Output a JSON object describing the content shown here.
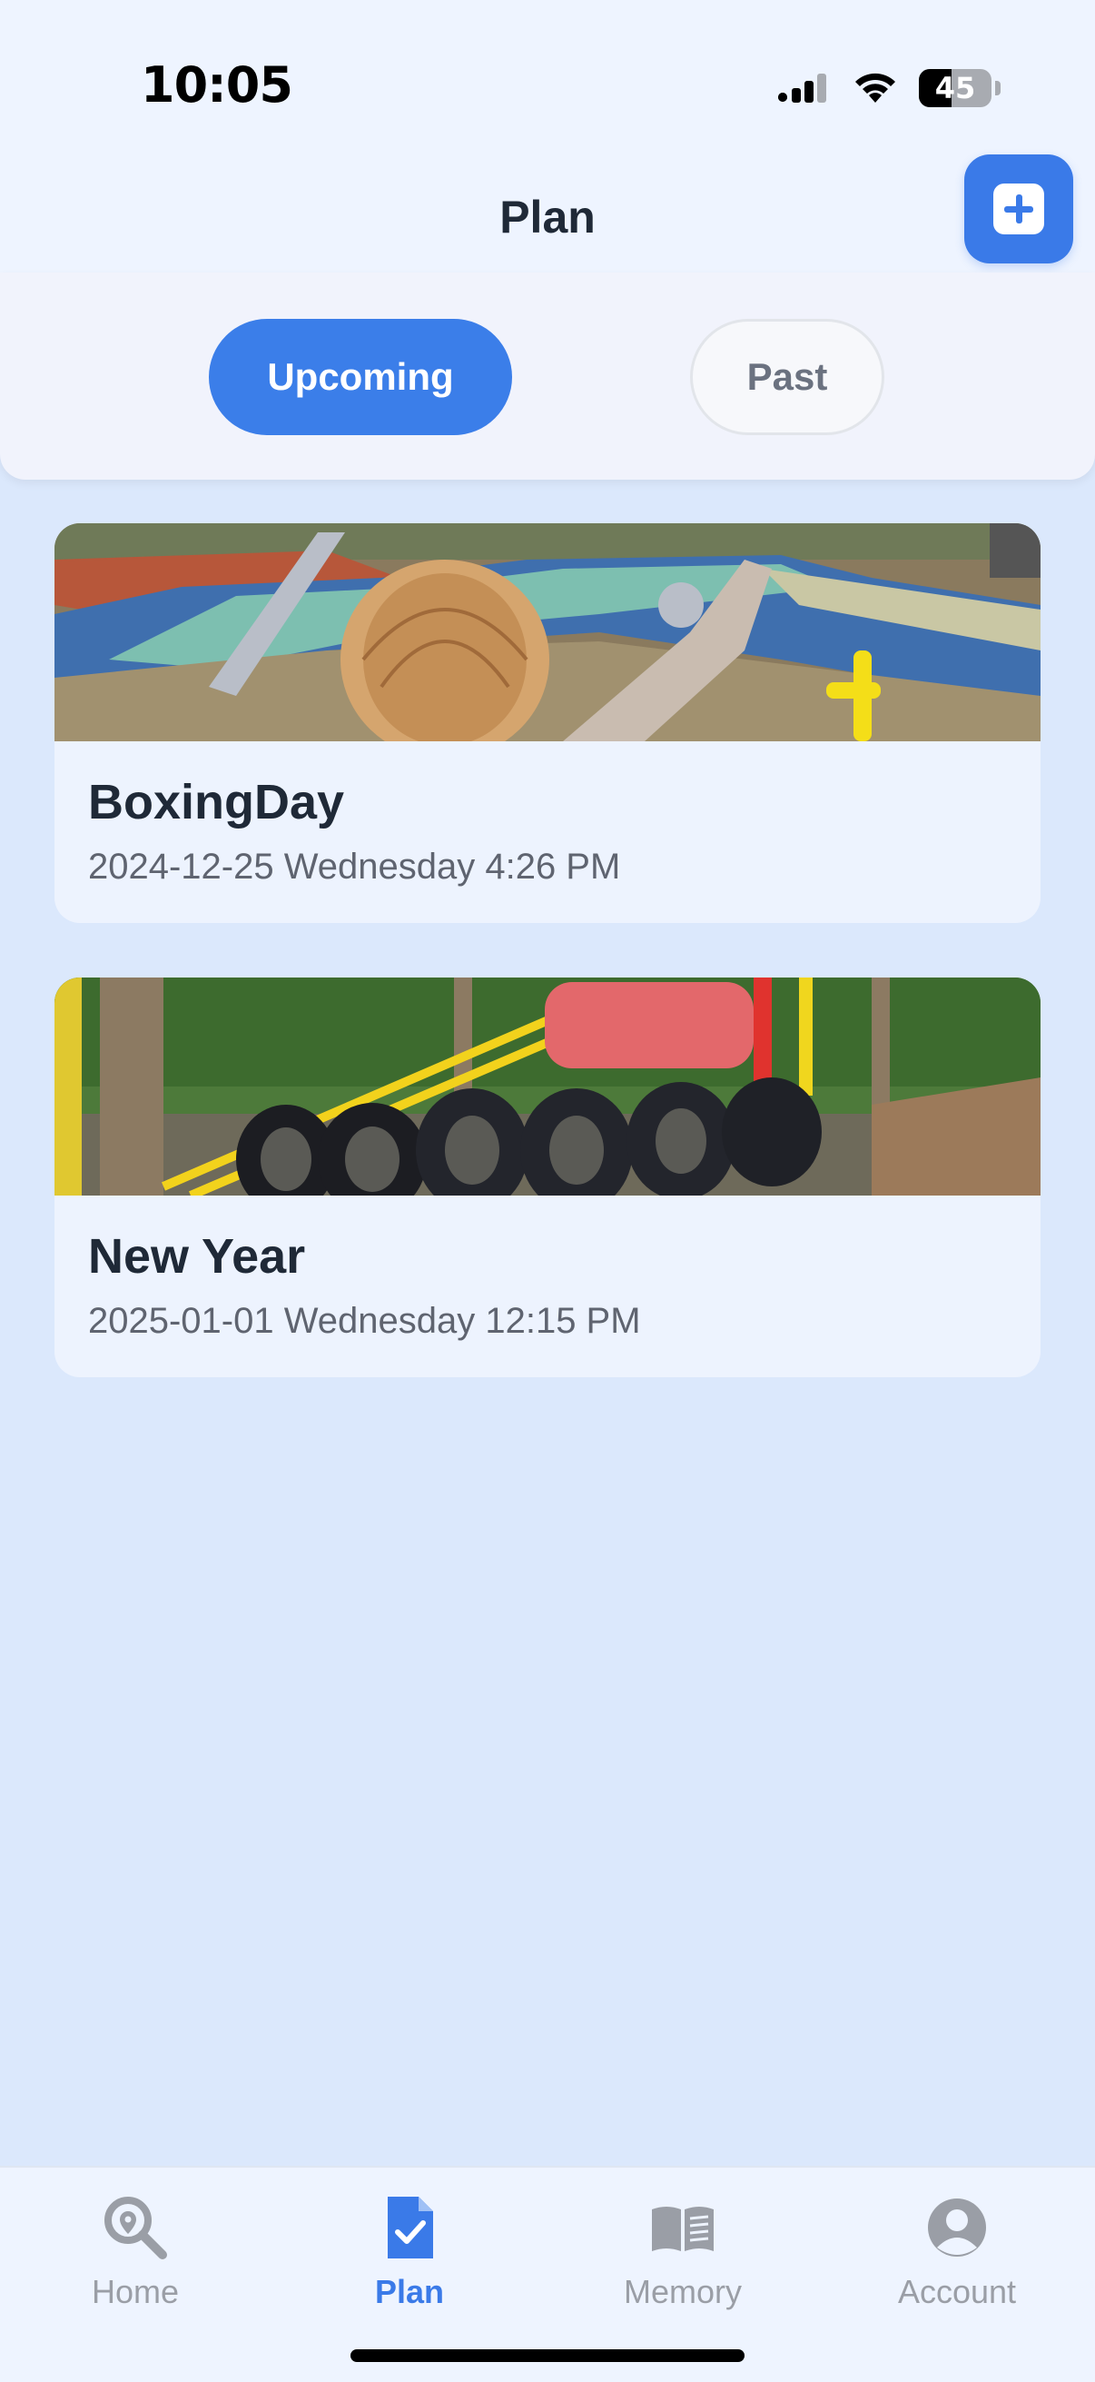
{
  "status_bar": {
    "time": "10:05",
    "battery": "45"
  },
  "header": {
    "title": "Plan"
  },
  "filter": {
    "upcoming_label": "Upcoming",
    "past_label": "Past"
  },
  "plans": [
    {
      "title": "BoxingDay",
      "date": "2024-12-25 Wednesday 4:26 PM"
    },
    {
      "title": "New Year",
      "date": "2025-01-01 Wednesday 12:15 PM"
    }
  ],
  "tabbar": {
    "items": [
      {
        "label": "Home",
        "icon": "search-pin-icon"
      },
      {
        "label": "Plan",
        "icon": "plan-document-icon"
      },
      {
        "label": "Memory",
        "icon": "book-icon"
      },
      {
        "label": "Account",
        "icon": "person-icon"
      }
    ],
    "active": "Plan"
  },
  "colors": {
    "accent": "#3a7ae8",
    "background": "#dbe8fc",
    "inactive": "#9a9ea6"
  }
}
